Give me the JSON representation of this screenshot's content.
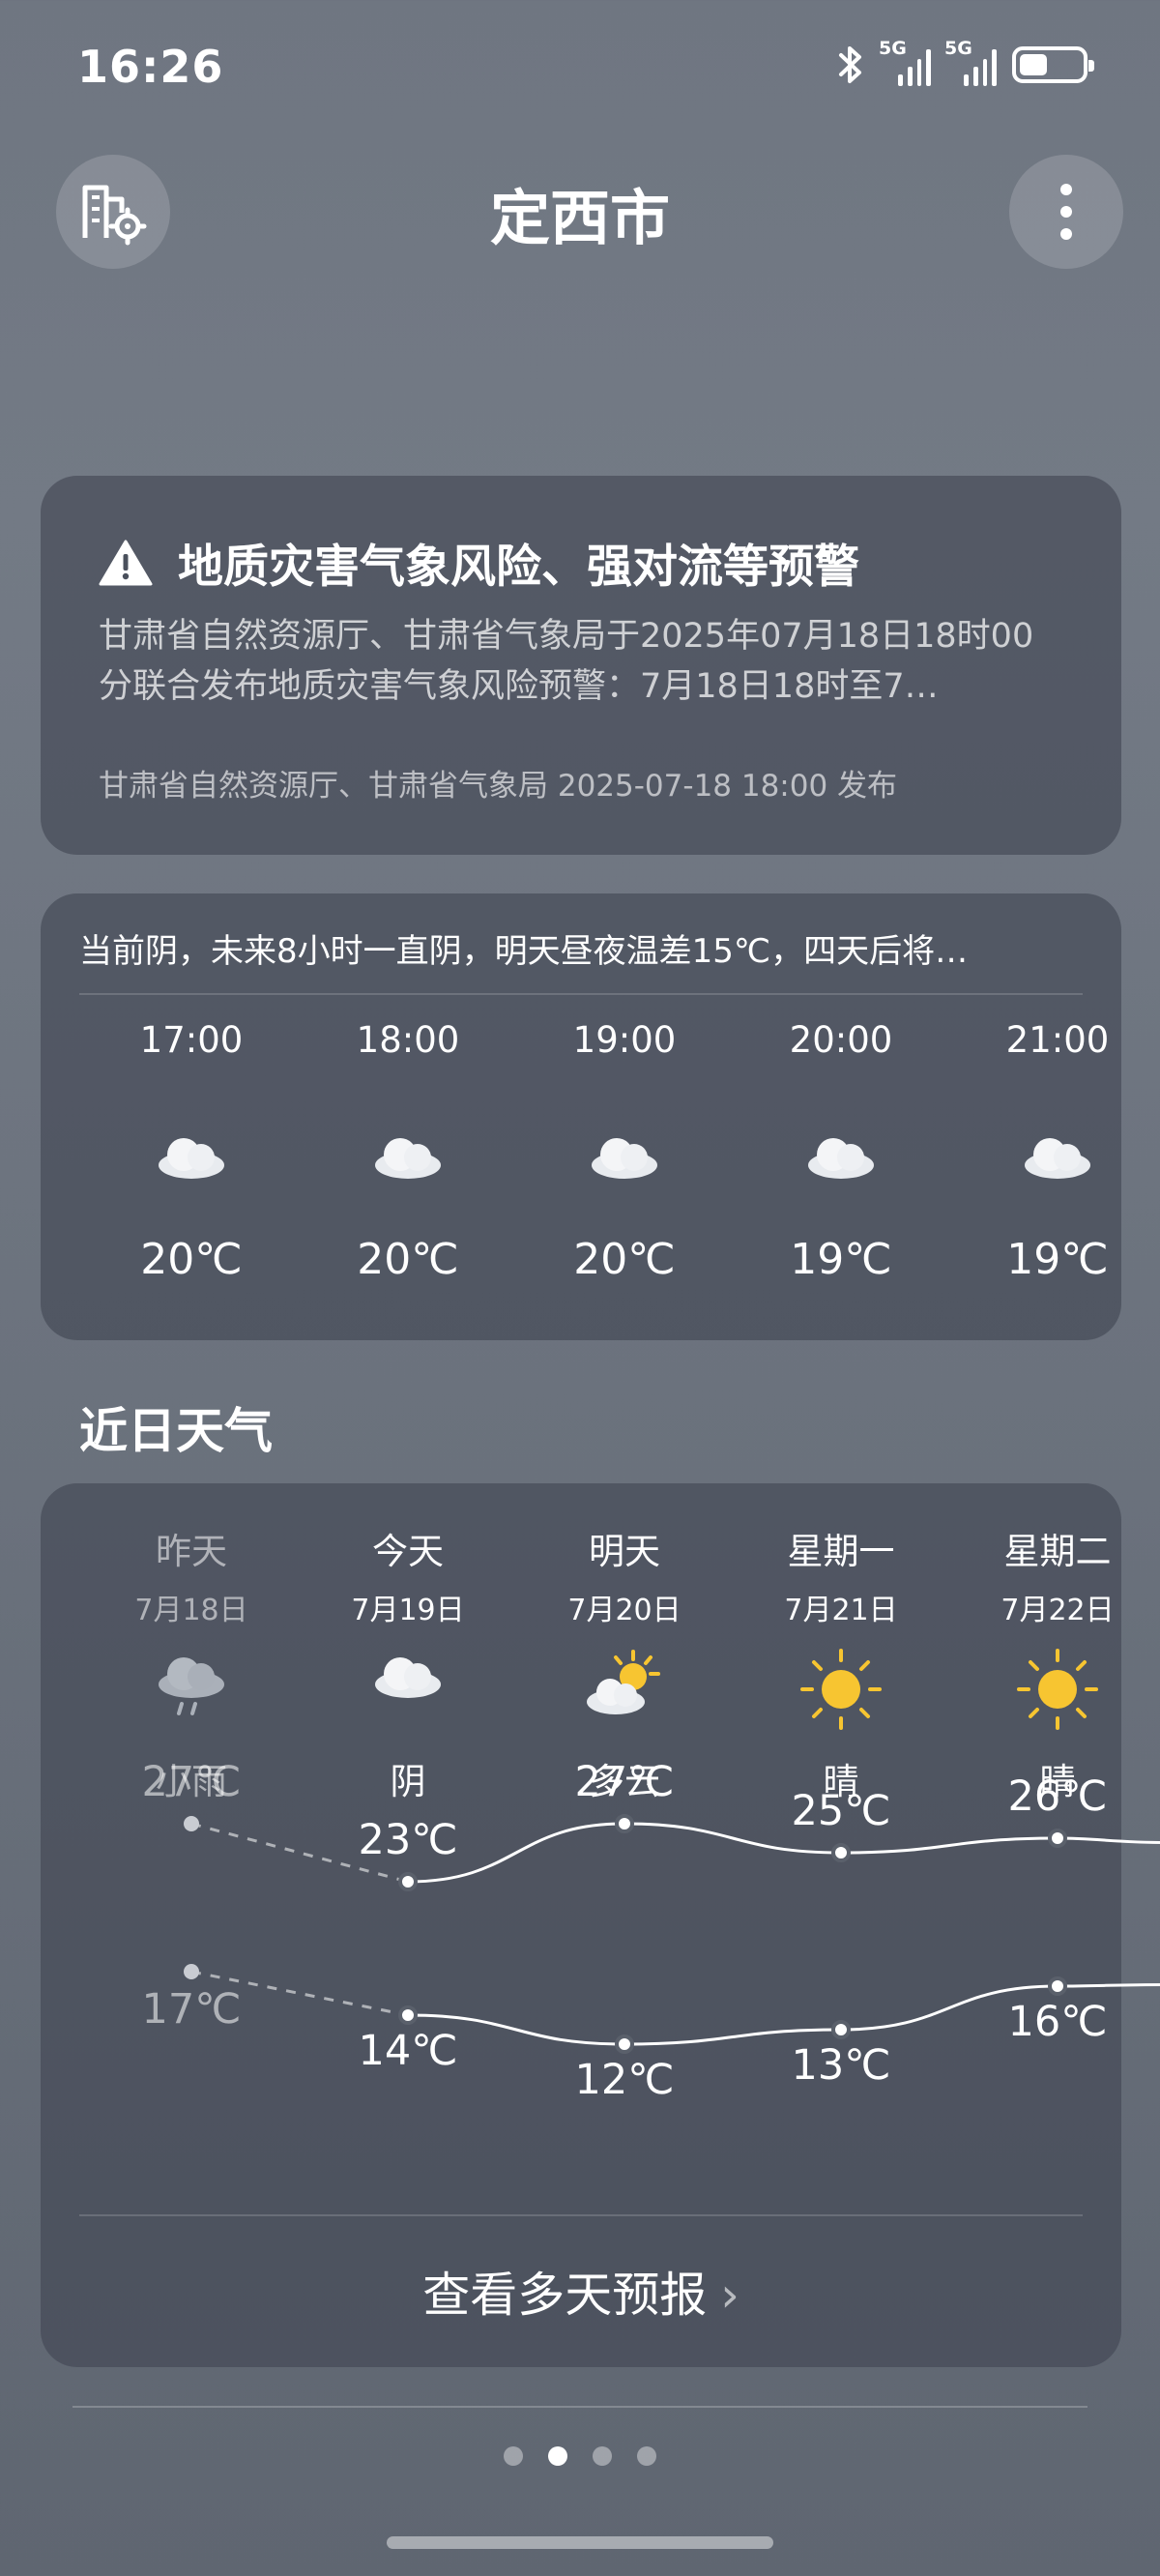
{
  "status_bar": {
    "time": "16:26",
    "network_1": "5G",
    "network_2": "5G"
  },
  "header": {
    "city": "定西市"
  },
  "alert": {
    "title": "地质灾害气象风险、强对流等预警",
    "body": "甘肃省自然资源厅、甘肃省气象局于2025年07月18日18时00分联合发布地质灾害气象风险预警：7月18日18时至7…",
    "source": "甘肃省自然资源厅、甘肃省气象局 2025-07-18 18:00 发布"
  },
  "hourly": {
    "summary": "当前阴，未来8小时一直阴，明天昼夜温差15℃，四天后将…",
    "items": [
      {
        "time": "17:00",
        "icon": "cloud-icon",
        "temp": "20℃"
      },
      {
        "time": "18:00",
        "icon": "cloud-icon",
        "temp": "20℃"
      },
      {
        "time": "19:00",
        "icon": "cloud-icon",
        "temp": "20℃"
      },
      {
        "time": "20:00",
        "icon": "cloud-icon",
        "temp": "19℃"
      },
      {
        "time": "21:00",
        "icon": "cloud-icon",
        "temp": "19℃"
      }
    ]
  },
  "daily": {
    "title": "近日天气",
    "days": [
      {
        "day": "昨天",
        "date": "7月18日",
        "icon": "rain-cloud-icon",
        "condition": "小雨",
        "high": "27℃",
        "low": "17℃",
        "high_value": 27,
        "low_value": 17
      },
      {
        "day": "今天",
        "date": "7月19日",
        "icon": "cloud-icon",
        "condition": "阴",
        "high": "23℃",
        "low": "14℃",
        "high_value": 23,
        "low_value": 14
      },
      {
        "day": "明天",
        "date": "7月20日",
        "icon": "partly-cloudy-icon",
        "condition": "多云",
        "high": "27℃",
        "low": "12℃",
        "high_value": 27,
        "low_value": 12
      },
      {
        "day": "星期一",
        "date": "7月21日",
        "icon": "sun-icon",
        "condition": "晴",
        "high": "25℃",
        "low": "13℃",
        "high_value": 25,
        "low_value": 13
      },
      {
        "day": "星期二",
        "date": "7月22日",
        "icon": "sun-icon",
        "condition": "晴",
        "high": "26℃",
        "low": "16℃",
        "high_value": 26,
        "low_value": 16
      }
    ],
    "more_label": "查看多天预报"
  },
  "pager": {
    "count": 4,
    "active_index": 1
  },
  "colors": {
    "sun": "#f7c531",
    "card_bg": "#404652"
  }
}
